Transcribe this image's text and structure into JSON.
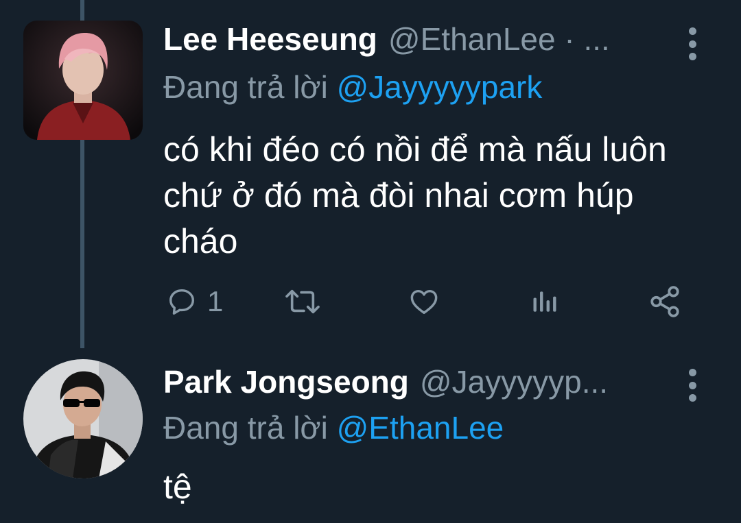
{
  "tweets": [
    {
      "display_name": "Lee Heeseung",
      "handle": "@EthanLee · ...",
      "reply_prefix": "Đang trả lời",
      "reply_to": "@Jayyyyypark",
      "text": "có khi đéo có nồi để mà nấu luôn chứ ở đó mà đòi nhai cơm húp cháo",
      "reply_count": "1",
      "avatar_icon": "profile-photo-pink-hair"
    },
    {
      "display_name": "Park Jongseong",
      "handle": "@Jayyyyyp...",
      "reply_prefix": "Đang trả lời",
      "reply_to": "@EthanLee",
      "text": "tệ",
      "avatar_icon": "profile-photo-sunglasses"
    }
  ],
  "colors": {
    "background": "#15202b",
    "primary_text": "#ffffff",
    "secondary_text": "#8899a6",
    "link": "#1da1f2",
    "thread_line": "#3d5466"
  },
  "icons": [
    "reply-icon",
    "retweet-icon",
    "like-icon",
    "analytics-icon",
    "share-icon",
    "more-icon"
  ]
}
